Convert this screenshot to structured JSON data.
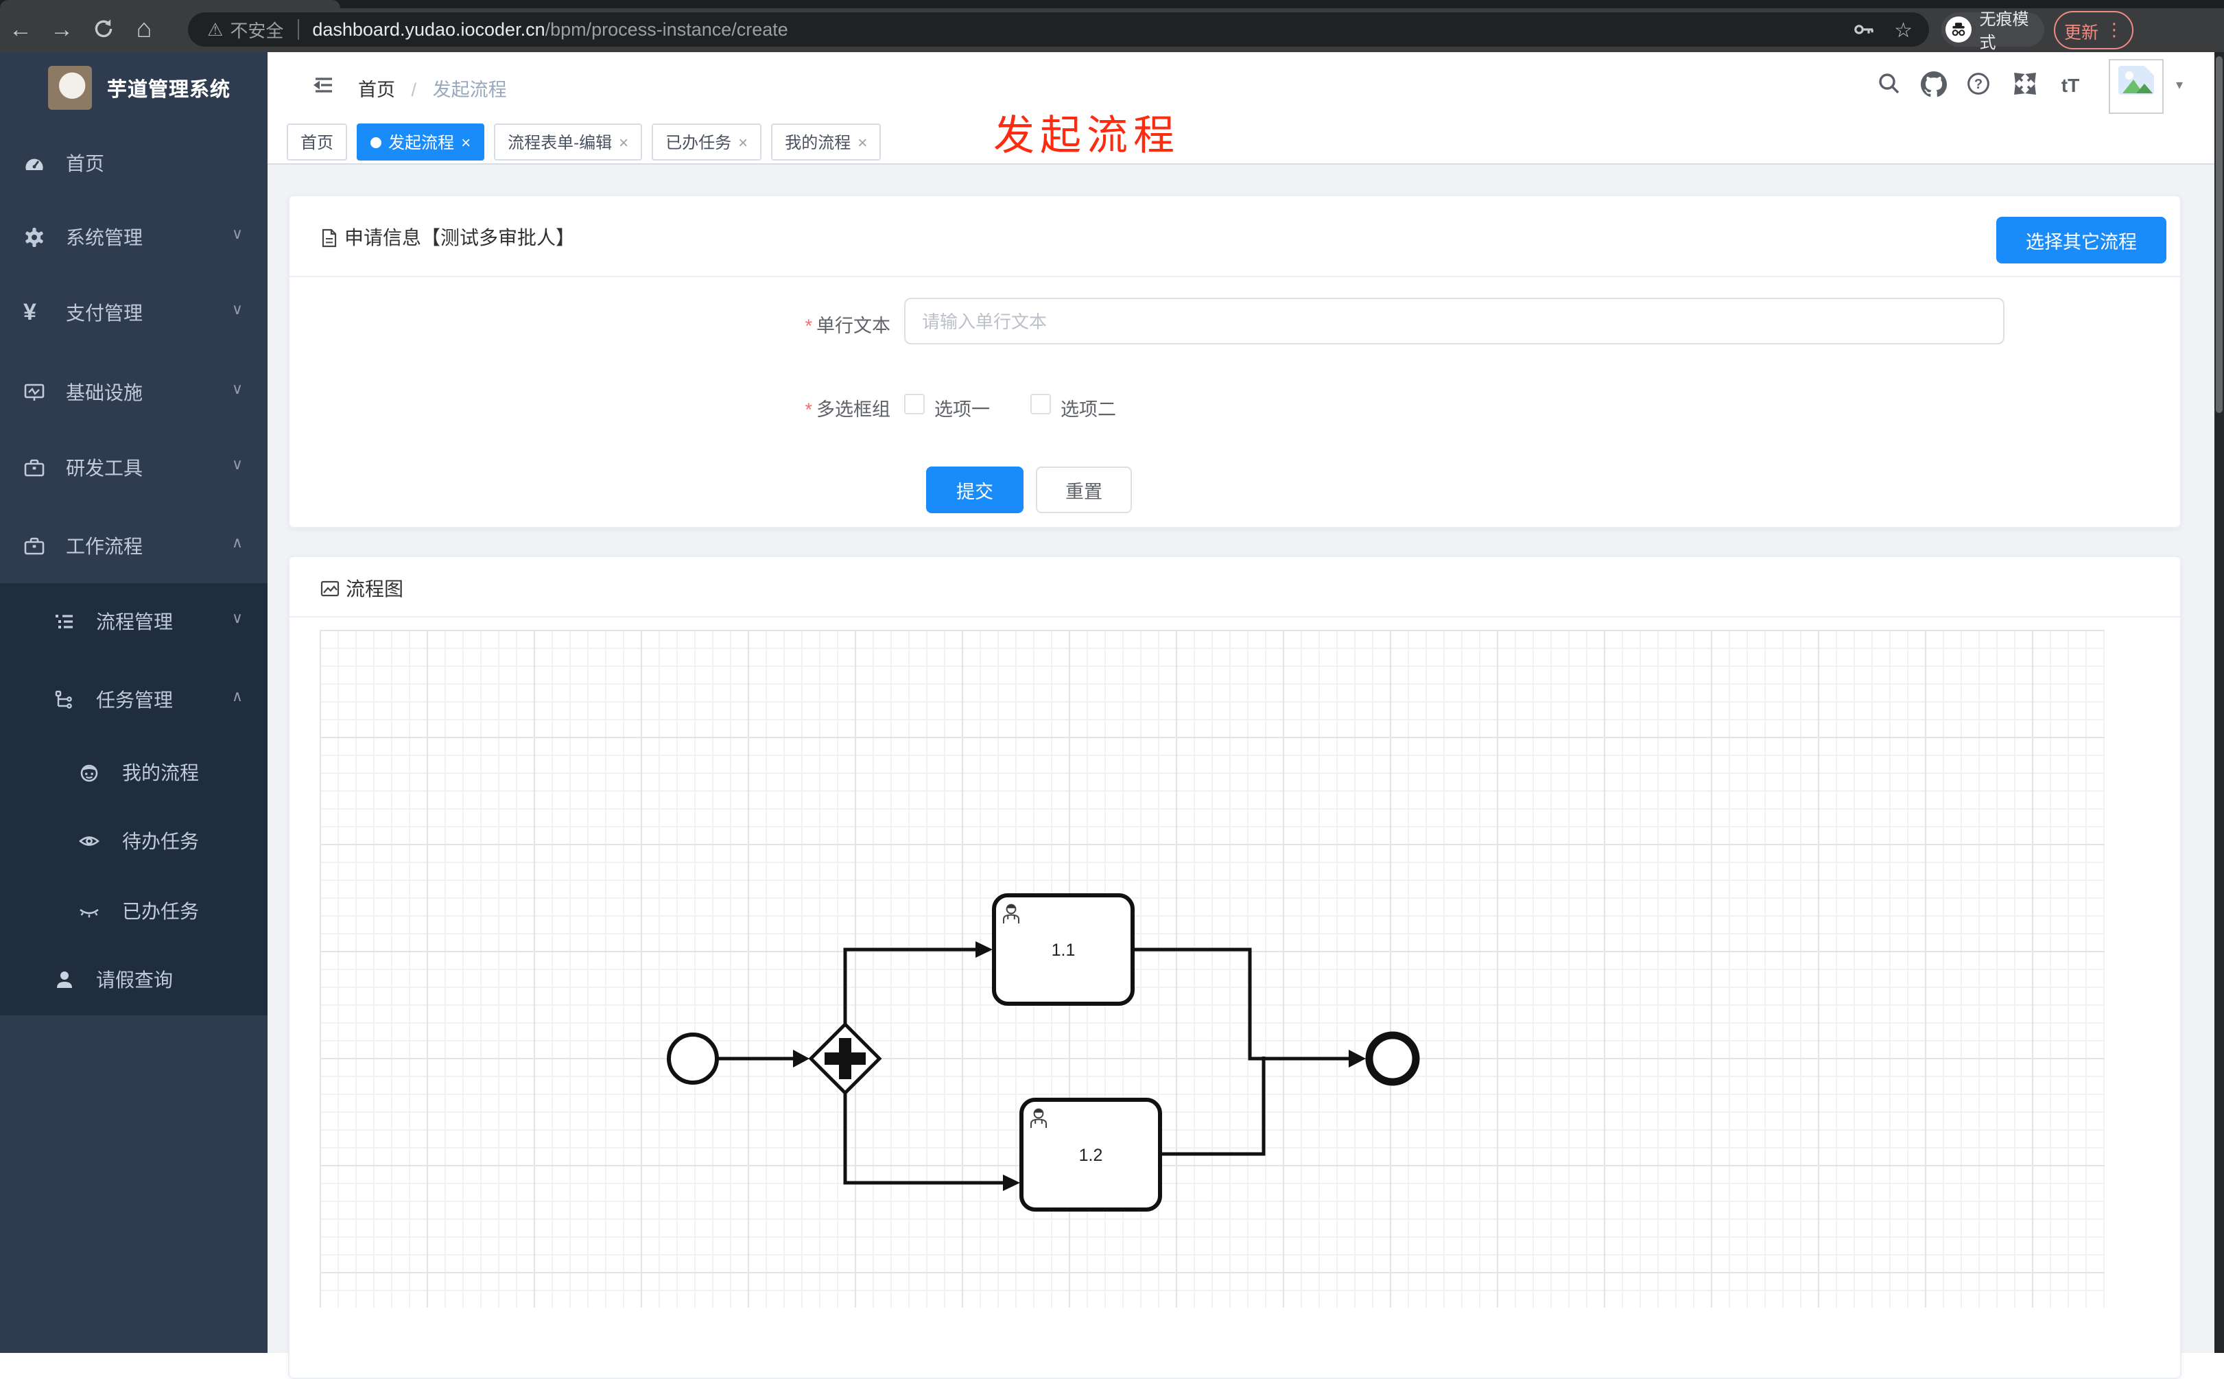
{
  "browser": {
    "back_icon": "←",
    "forward_icon": "→",
    "home_icon": "⌂",
    "warning_icon": "⚠",
    "security_label": "不安全",
    "url_host": "dashboard.yudao.iocoder.cn",
    "url_path": "/bpm/process-instance/create",
    "star_icon": "☆",
    "incognito_label": "无痕模式",
    "update_label": "更新",
    "kebab_icon": "⋮"
  },
  "overlay_title": "发起流程",
  "sidebar": {
    "app_title": "芋道管理系统",
    "items": [
      {
        "label": "首页"
      },
      {
        "label": "系统管理"
      },
      {
        "label": "支付管理"
      },
      {
        "label": "基础设施"
      },
      {
        "label": "研发工具"
      },
      {
        "label": "工作流程"
      }
    ],
    "workflow_children": [
      {
        "label": "流程管理"
      },
      {
        "label": "任务管理"
      },
      {
        "label": "请假查询"
      }
    ],
    "task_children": [
      {
        "label": "我的流程"
      },
      {
        "label": "待办任务"
      },
      {
        "label": "已办任务"
      }
    ],
    "yen_icon": "¥",
    "chevron_down": "∨",
    "chevron_up": "∧"
  },
  "header": {
    "breadcrumb_home": "首页",
    "breadcrumb_sep": "/",
    "breadcrumb_current": "发起流程",
    "font_size_icon": "tT",
    "caret_icon": "▾"
  },
  "tabs": {
    "t0": "首页",
    "t1": "发起流程",
    "t2": "流程表单-编辑",
    "t3": "已办任务",
    "t4": "我的流程",
    "close_icon": "×"
  },
  "form_card": {
    "title": "申请信息【测试多审批人】",
    "choose_other_label": "选择其它流程",
    "required_mark": "*",
    "field1_label": "单行文本",
    "field1_placeholder": "请输入单行文本",
    "field2_label": "多选框组",
    "option1": "选项一",
    "option2": "选项二",
    "submit_label": "提交",
    "reset_label": "重置"
  },
  "diagram_card": {
    "title": "流程图",
    "task1_label": "1.1",
    "task2_label": "1.2"
  },
  "colors": {
    "primary_blue": "#1a8cfa",
    "overlay_red": "#fe2b10",
    "sidebar_bg": "#2f3b4e",
    "submenu_bg": "#1f2d3d",
    "update_salmon": "#f28b82",
    "required_red": "#f56c6c"
  }
}
